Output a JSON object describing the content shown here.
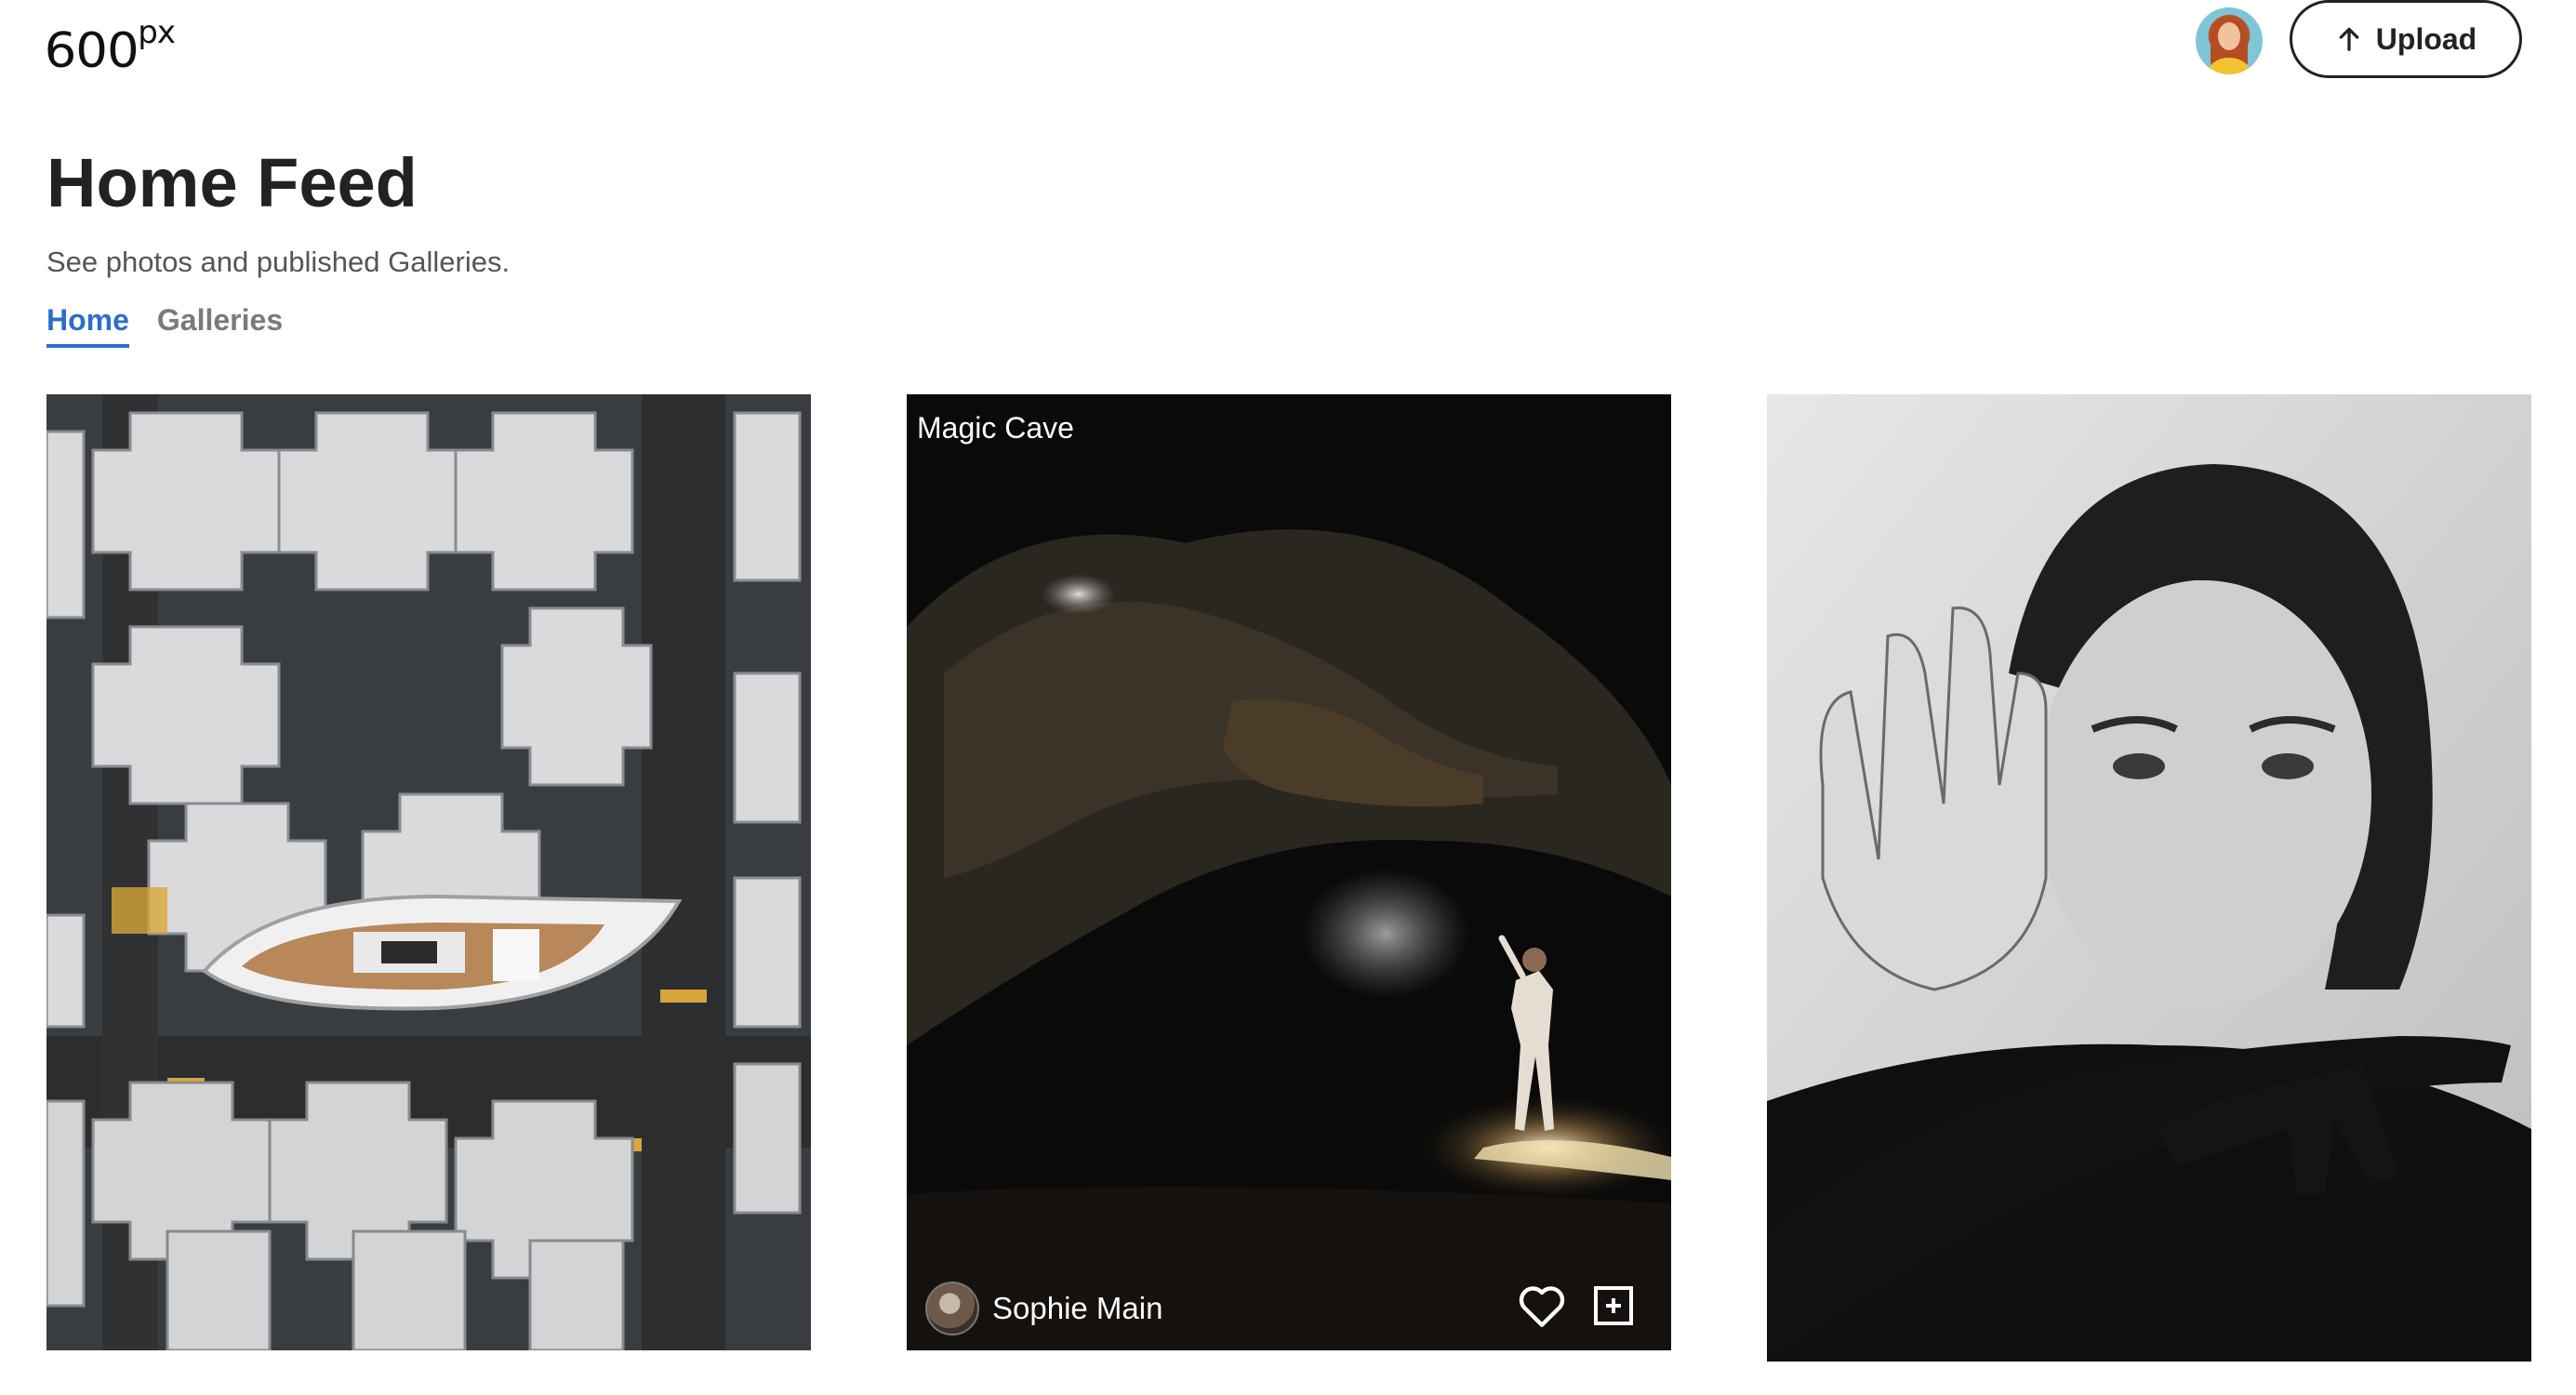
{
  "header": {
    "logo_text": "600",
    "logo_suffix": "px",
    "upload_label": "Upload"
  },
  "feed": {
    "title": "Home Feed",
    "subtitle": "See photos and published Galleries.",
    "tabs": [
      {
        "label": "Home",
        "active": true
      },
      {
        "label": "Galleries",
        "active": false
      }
    ]
  },
  "photos": [
    {
      "subject": "aerial city with ship-shaped building"
    },
    {
      "title": "Magic Cave",
      "author": "Sophie Main",
      "icons": [
        "heart-icon",
        "add-to-gallery-icon"
      ]
    },
    {
      "subject": "black and white portrait with hands"
    }
  ],
  "colors": {
    "accent": "#2d6dca",
    "text": "#222222",
    "muted": "#7a7a7a"
  }
}
